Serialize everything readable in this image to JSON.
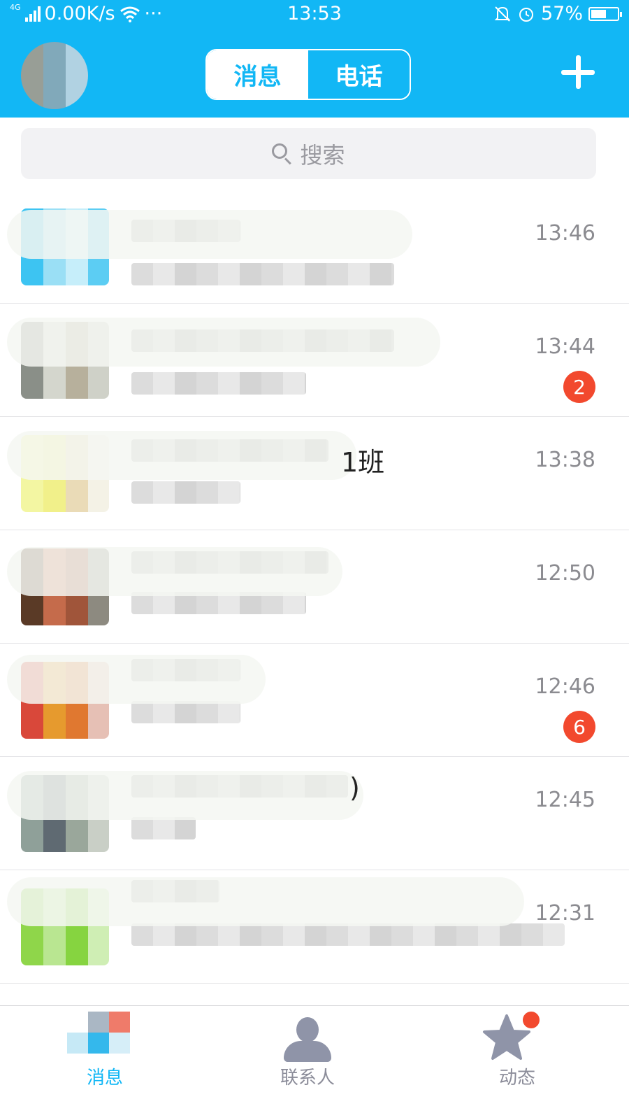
{
  "status_bar": {
    "network_type": "4G",
    "speed": "0.00K/s",
    "more": "···",
    "time": "13:53",
    "battery": "57%",
    "battery_level": 0.57,
    "icons": [
      "signal-icon",
      "wifi-icon",
      "bell-mute-icon",
      "alarm-icon",
      "battery-icon"
    ]
  },
  "header": {
    "tabs": [
      {
        "label": "消息",
        "active": true
      },
      {
        "label": "电话",
        "active": false
      }
    ],
    "plus_icon": "plus-icon"
  },
  "search": {
    "placeholder": "搜索",
    "icon": "search-icon"
  },
  "conversations": [
    {
      "time": "13:46",
      "badge": ""
    },
    {
      "time": "13:44",
      "badge": "2"
    },
    {
      "time": "13:38",
      "badge": "",
      "visible_fragment": "1班"
    },
    {
      "time": "12:50",
      "badge": ""
    },
    {
      "time": "12:46",
      "badge": "6"
    },
    {
      "time": "12:45",
      "badge": "",
      "visible_fragment": ")"
    },
    {
      "time": "12:31",
      "badge": ""
    }
  ],
  "tabbar": {
    "items": [
      {
        "label": "消息",
        "icon": "messages-icon",
        "active": true
      },
      {
        "label": "联系人",
        "icon": "contacts-icon",
        "active": false
      },
      {
        "label": "动态",
        "icon": "star-icon",
        "active": false
      }
    ]
  },
  "colors": {
    "brand": "#12b7f5",
    "badge": "#f2492e",
    "time_text": "#8b8b90",
    "inactive_tab": "#8b8c99"
  }
}
